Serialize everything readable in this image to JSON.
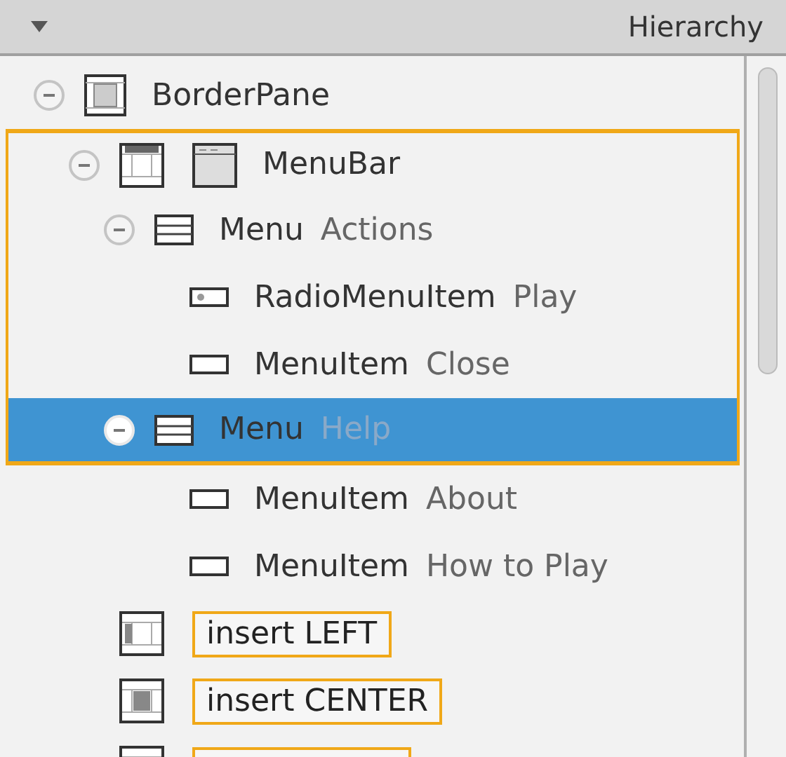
{
  "panel": {
    "title": "Hierarchy"
  },
  "tree": [
    {
      "kind": "pane",
      "type": "BorderPane",
      "expanded": true,
      "selected": false,
      "drop_zone": false,
      "children": [
        {
          "kind": "menubar",
          "type": "MenuBar",
          "expanded": true,
          "selected": false,
          "drop_zone": true,
          "children": [
            {
              "kind": "menu",
              "type": "Menu",
              "name": "Actions",
              "expanded": true,
              "selected": false,
              "drop_zone": true,
              "children": [
                {
                  "kind": "radio",
                  "type": "RadioMenuItem",
                  "name": "Play",
                  "selected": false,
                  "drop_zone": true
                },
                {
                  "kind": "item",
                  "type": "MenuItem",
                  "name": "Close",
                  "selected": false,
                  "drop_zone": true
                }
              ]
            },
            {
              "kind": "menu",
              "type": "Menu",
              "name": "Help",
              "expanded": true,
              "selected": true,
              "drop_zone": true,
              "children": [
                {
                  "kind": "item",
                  "type": "MenuItem",
                  "name": "About",
                  "selected": false,
                  "drop_zone": false
                },
                {
                  "kind": "item",
                  "type": "MenuItem",
                  "name": "How to Play",
                  "selected": false,
                  "drop_zone": false
                }
              ]
            }
          ]
        },
        {
          "kind": "leftslot",
          "label": "insert LEFT"
        },
        {
          "kind": "centerslot",
          "label": "insert CENTER"
        },
        {
          "kind": "rightslot"
        }
      ]
    }
  ]
}
